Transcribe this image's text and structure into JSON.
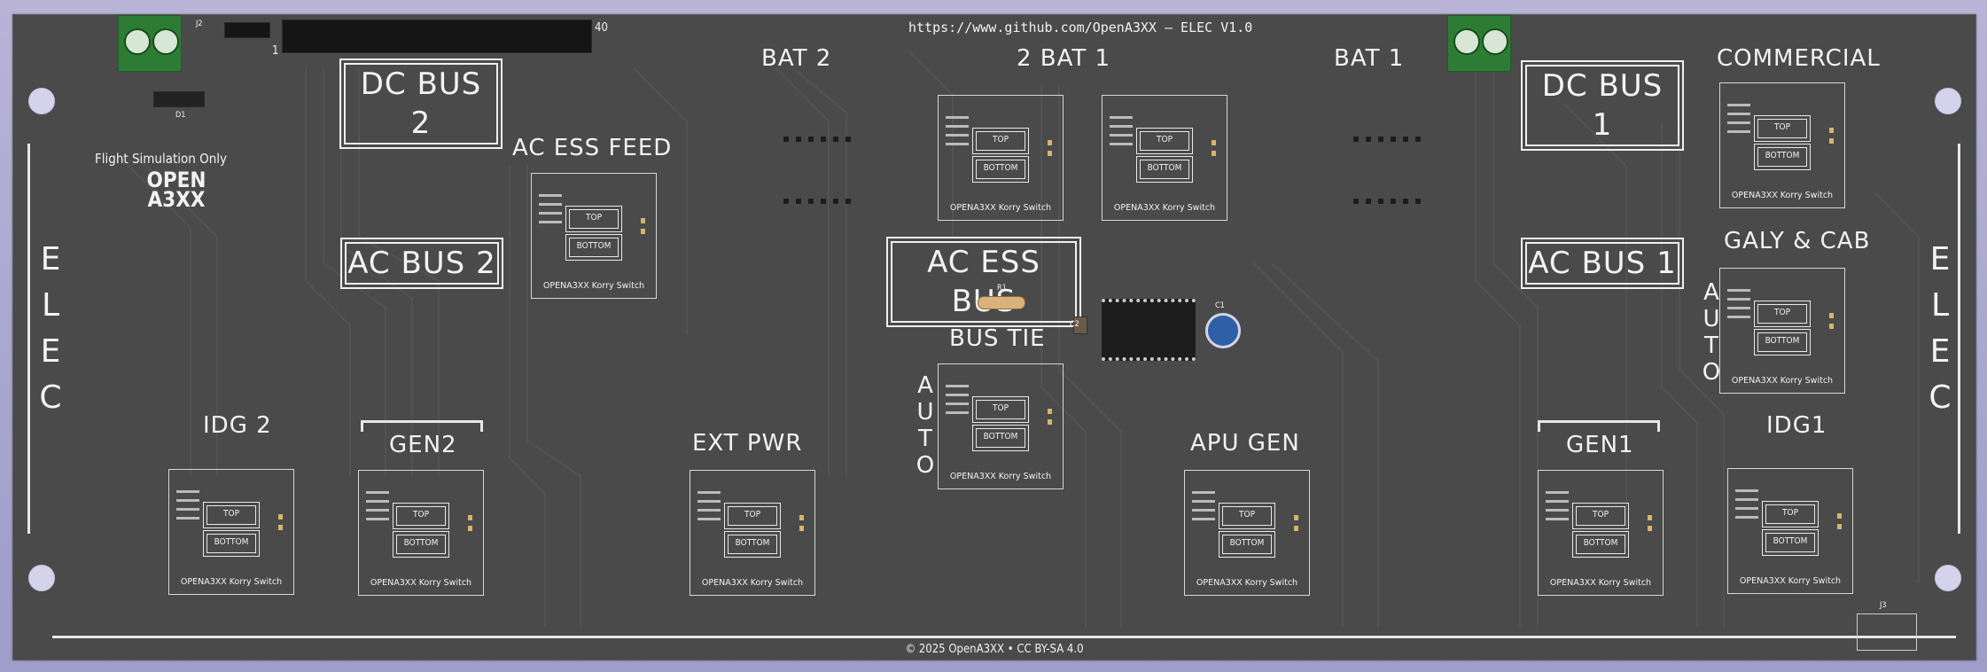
{
  "board": {
    "url": "https://www.github.com/OpenA3XX — ELEC V1.0",
    "footer": "© 2025 OpenA3XX • CC BY-SA 4.0",
    "sim_note": "Flight Simulation Only",
    "logo": "OPEN A3XX",
    "side_text": "ELEC",
    "auto_text": "AUTO",
    "pin1": "1",
    "pin40": "40",
    "d1": "D1",
    "r1": "R1",
    "c1": "C1",
    "c2": "C2",
    "j3": "J3",
    "j2": "J2"
  },
  "bus_labels": {
    "dc_bus_2": "DC BUS 2",
    "dc_bus_1": "DC BUS 1",
    "ac_bus_2": "AC BUS 2",
    "ac_bus_1": "AC BUS 1",
    "ac_ess_bus": "AC ESS BUS"
  },
  "titles": {
    "bat2": "BAT 2",
    "bat_mid": "2   BAT   1",
    "bat1": "BAT 1",
    "commercial": "COMMERCIAL",
    "galy_cab": "GALY & CAB",
    "ac_ess_feed": "AC  ESS  FEED",
    "bus_tie": "BUS  TIE",
    "idg2": "IDG 2",
    "gen2": "GEN2",
    "ext_pwr": "EXT  PWR",
    "apu_gen": "APU  GEN",
    "gen1": "GEN1",
    "idg1": "IDG1"
  },
  "switch": {
    "top": "TOP",
    "bottom": "BOTTOM",
    "caption": "OPENA3XX Korry Switch"
  },
  "colors": {
    "board": "#4a4a4a",
    "silkscreen": "#f2f2f2",
    "terminal_green": "#2d7c36",
    "background": "#aaa7d0"
  }
}
